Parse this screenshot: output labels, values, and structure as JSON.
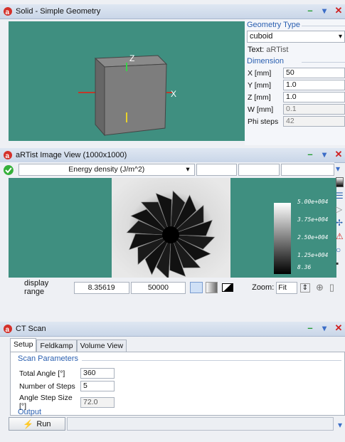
{
  "geometry_panel": {
    "title": "Solid - Simple Geometry",
    "type_section": "Geometry Type",
    "type_value": "cuboid",
    "text_label": "Text:",
    "text_value": "aRTist",
    "dimension_section": "Dimension",
    "fields": [
      {
        "label": "X [mm]",
        "value": "50",
        "disabled": false
      },
      {
        "label": "Y [mm]",
        "value": "1.0",
        "disabled": false
      },
      {
        "label": "Z [mm]",
        "value": "1.0",
        "disabled": false
      },
      {
        "label": "W [mm]",
        "value": "0.1",
        "disabled": true
      },
      {
        "label": "Phi steps",
        "value": "42",
        "disabled": true
      }
    ],
    "axis_labels": {
      "z": "Z",
      "x": "X"
    }
  },
  "image_view": {
    "title": "aRTist Image View (1000x1000)",
    "quantity_select": "Energy density (J/m^2)",
    "colorbar_ticks": [
      "5.00e+004",
      "3.75e+004",
      "2.50e+004",
      "1.25e+004",
      "8.36"
    ],
    "display_range_label": "display range",
    "range_min": "8.35619",
    "range_max": "50000",
    "zoom_label": "Zoom:",
    "zoom_value": "Fit"
  },
  "ct_scan": {
    "title": "CT Scan",
    "tabs": [
      "Setup",
      "Feldkamp",
      "Volume View"
    ],
    "section": "Scan Parameters",
    "fields": [
      {
        "label": "Total Angle [°]",
        "value": "360",
        "disabled": false
      },
      {
        "label": "Number of Steps",
        "value": "5",
        "disabled": false
      },
      {
        "label": "Angle Step Size [°]",
        "value": "72.0",
        "disabled": true
      }
    ],
    "output_section": "Output",
    "run_label": "Run"
  },
  "colors": {
    "viewport": "#3f8f80",
    "accent": "#2a5fb0"
  }
}
